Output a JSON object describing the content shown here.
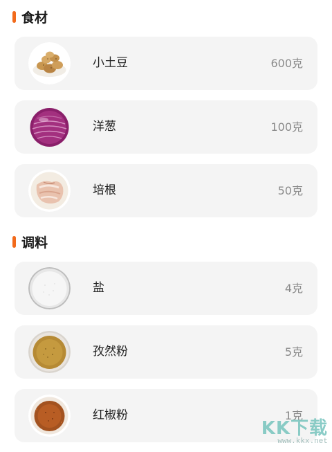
{
  "sections": [
    {
      "title": "食材",
      "items": [
        {
          "name": "小土豆",
          "qty": "600克",
          "icon": "potatoes-icon"
        },
        {
          "name": "洋葱",
          "qty": "100克",
          "icon": "red-onion-icon"
        },
        {
          "name": "培根",
          "qty": "50克",
          "icon": "bacon-icon"
        }
      ]
    },
    {
      "title": "调料",
      "items": [
        {
          "name": "盐",
          "qty": "4克",
          "icon": "salt-icon"
        },
        {
          "name": "孜然粉",
          "qty": "5克",
          "icon": "cumin-powder-icon"
        },
        {
          "name": "红椒粉",
          "qty": "1克",
          "icon": "paprika-powder-icon"
        }
      ]
    }
  ],
  "watermark": {
    "logo": "KK下载",
    "url": "www.kkx.net"
  },
  "colors": {
    "accent": "#f26a1b",
    "card_bg": "#f4f4f4",
    "name_text": "#222222",
    "qty_text": "#8a8a8a"
  }
}
